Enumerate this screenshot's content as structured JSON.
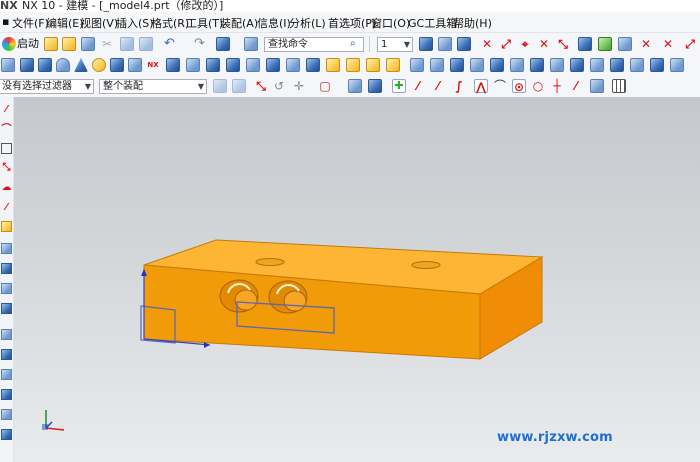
{
  "window": {
    "logo": "NX",
    "title": "NX 10 - 建模 - [_model4.prt（修改的）]"
  },
  "menu": [
    "文件(F)",
    "编辑(E)",
    "视图(V)",
    "插入(S)",
    "格式(R)",
    "工具(T)",
    "装配(A)",
    "信息(I)",
    "分析(L)",
    "首选项(P)",
    "窗口(O)",
    "GC工具箱",
    "帮助(H)"
  ],
  "toolbar": {
    "start_label": "启动",
    "search_placeholder": "查找命令",
    "layer_value": "1",
    "filter_value": "没有选择过滤器",
    "assembly_value": "整个装配"
  },
  "colors": {
    "part_top": "#fdb533",
    "part_front": "#f29b08",
    "part_side": "#f08c05",
    "edge": "#c47a0a",
    "selection": "#5a66b8"
  },
  "watermark": "www.rjzxw.com"
}
